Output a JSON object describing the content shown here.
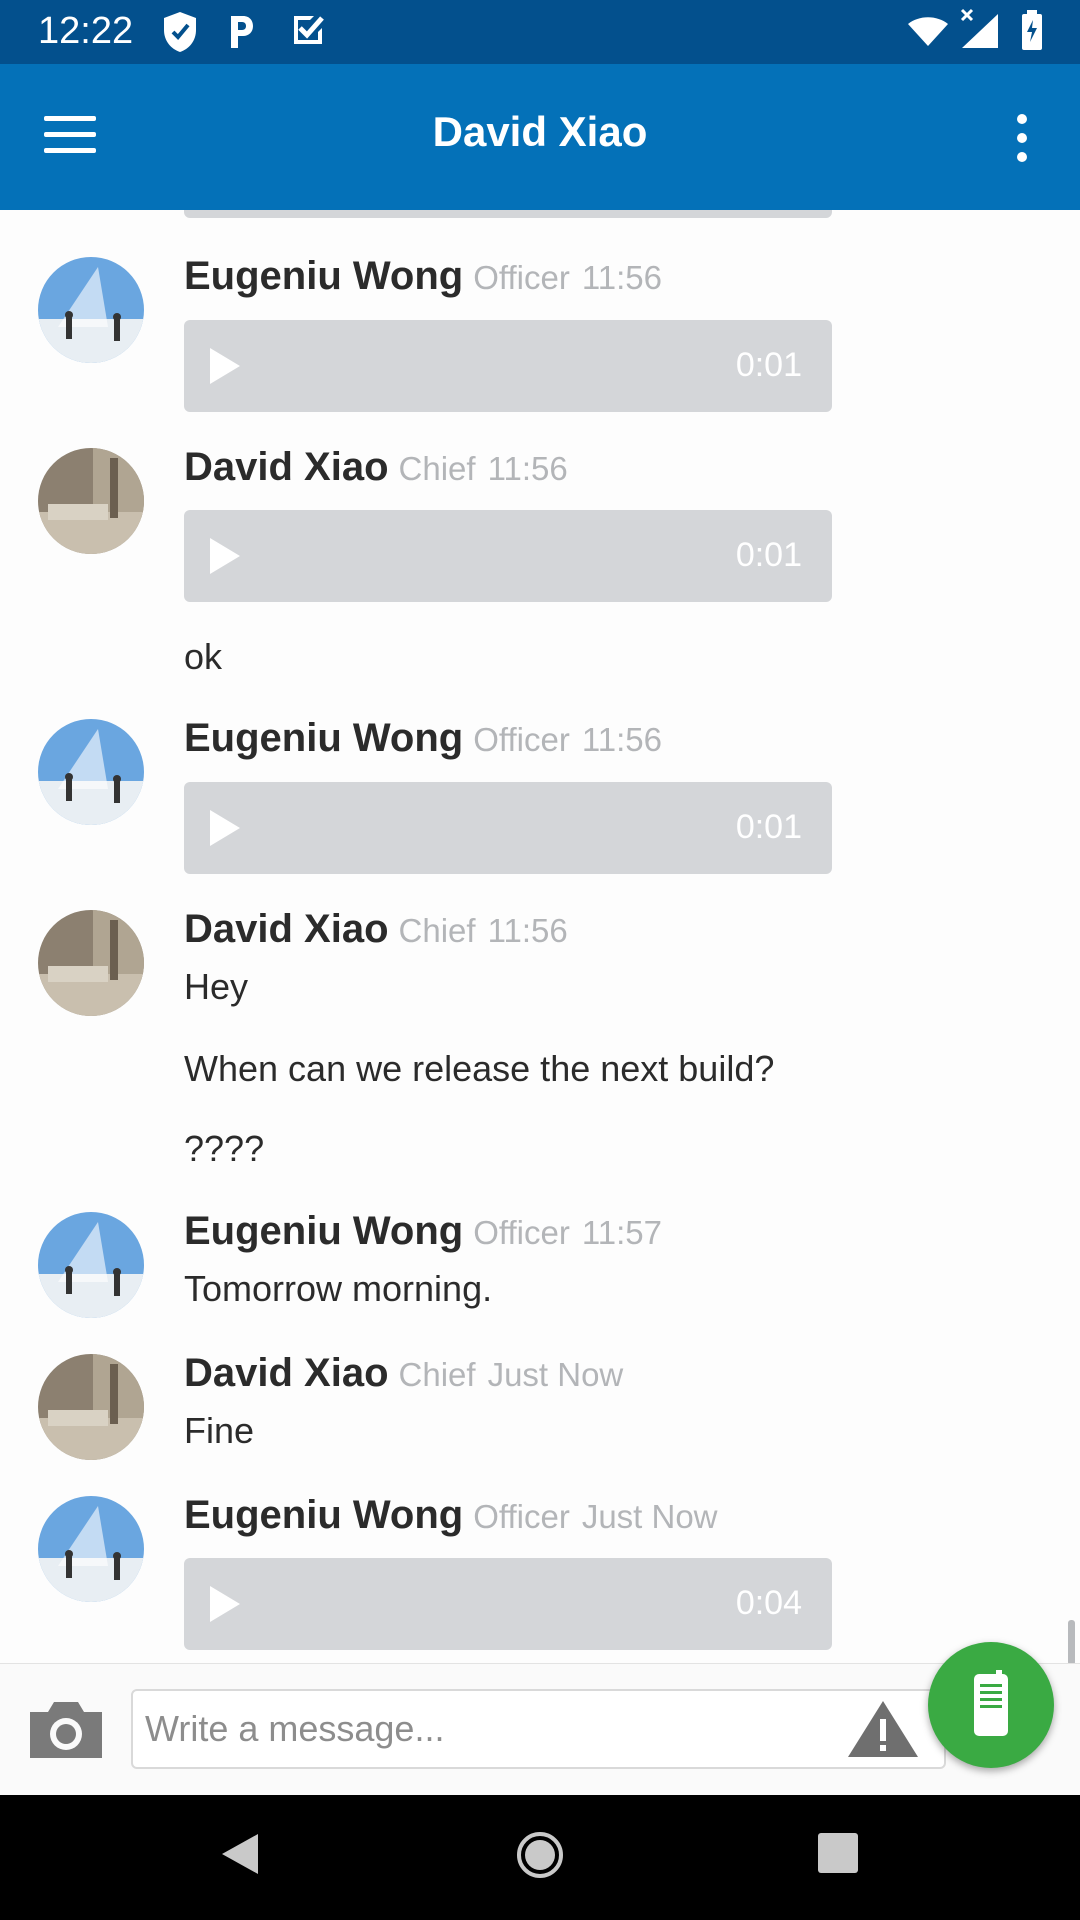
{
  "status_bar": {
    "time": "12:22"
  },
  "app_bar": {
    "title": "David Xiao"
  },
  "messages": [
    {
      "sender": "Eugeniu Wong",
      "role": "Officer",
      "time": "11:56",
      "audio": "0:01"
    },
    {
      "sender": "David Xiao",
      "role": "Chief",
      "time": "11:56",
      "audio": "0:01",
      "texts": [
        "ok"
      ]
    },
    {
      "sender": "Eugeniu Wong",
      "role": "Officer",
      "time": "11:56",
      "audio": "0:01"
    },
    {
      "sender": "David Xiao",
      "role": "Chief",
      "time": "11:56",
      "texts": [
        "Hey",
        "When can we release the next build?",
        "????"
      ]
    },
    {
      "sender": "Eugeniu Wong",
      "role": "Officer",
      "time": "11:57",
      "texts": [
        "Tomorrow morning."
      ]
    },
    {
      "sender": "David Xiao",
      "role": "Chief",
      "time": "Just Now",
      "texts": [
        "Fine"
      ]
    },
    {
      "sender": "Eugeniu Wong",
      "role": "Officer",
      "time": "Just Now",
      "audio": "0:04"
    }
  ],
  "composer": {
    "placeholder": "Write a message..."
  },
  "icons": {
    "status": [
      "shield-icon",
      "parking-icon",
      "checkbox-icon",
      "wifi-icon",
      "signal-icon",
      "battery-icon"
    ],
    "app_bar": [
      "menu-icon",
      "more-vert-icon"
    ],
    "composer": [
      "camera-icon",
      "warning-icon",
      "walkie-talkie-icon"
    ],
    "nav": [
      "back-icon",
      "home-icon",
      "recents-icon"
    ]
  },
  "colors": {
    "status_bar": "#03508d",
    "app_bar": "#0471b8",
    "audio_bubble": "#d4d6d9",
    "fab": "#3aaa43",
    "meta_text": "#b3b5b8"
  }
}
